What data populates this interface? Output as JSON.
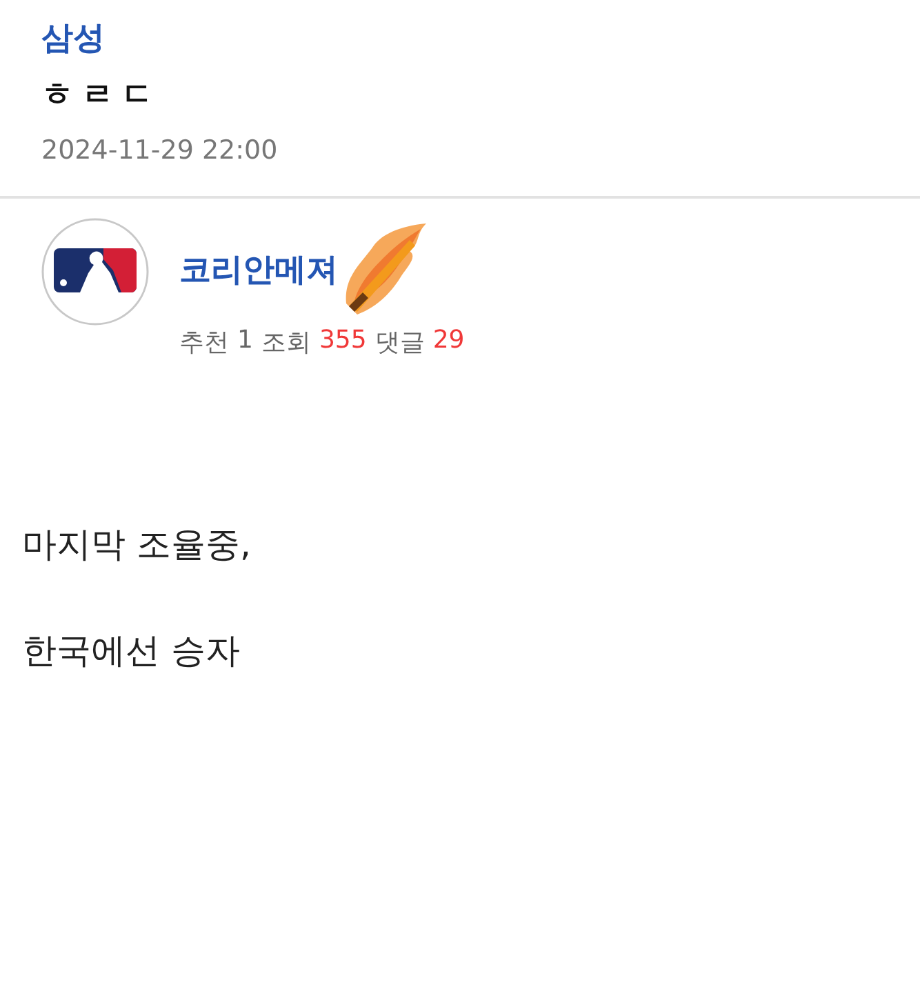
{
  "category": "삼성",
  "title": "ㅎㄹㄷ",
  "date": "2024-11-29 22:00",
  "author": {
    "name": "코리안메져"
  },
  "stats": [
    {
      "label": "추천",
      "value": "1",
      "highlight": false
    },
    {
      "label": "조회",
      "value": "355",
      "highlight": true
    },
    {
      "label": "댓글",
      "value": "29",
      "highlight": true
    }
  ],
  "body": [
    "마지막 조율중,",
    "한국에선 승자"
  ]
}
